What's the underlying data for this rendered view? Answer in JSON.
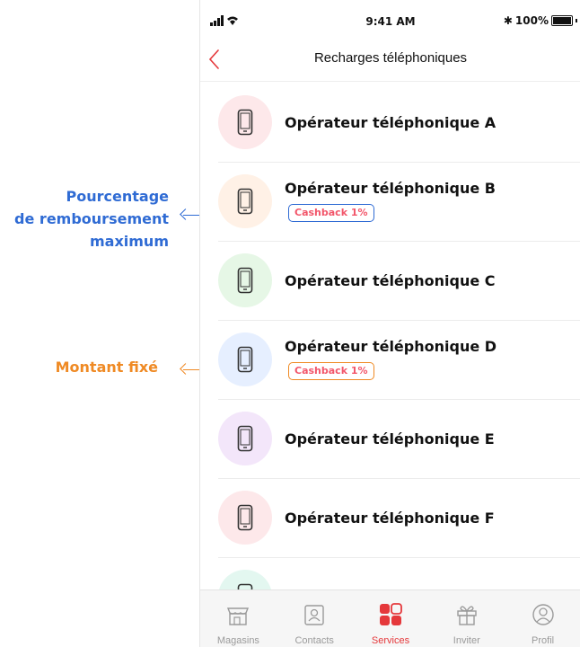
{
  "annotations": {
    "max_refund_lines": [
      "Pourcentage",
      "de remboursement",
      "maximum"
    ],
    "fixed_amount": "Montant fixé",
    "blue_color": "#2f6bd4",
    "orange_color": "#ef8a24"
  },
  "status_bar": {
    "time": "9:41 AM",
    "battery": "100%",
    "icons": [
      "signal-icon",
      "wifi-icon",
      "bluetooth-icon",
      "battery-icon"
    ]
  },
  "nav": {
    "title": "Recharges téléphoniques",
    "back_icon": "chevron-left-icon"
  },
  "operators": [
    {
      "name": "Opérateur téléphonique A",
      "badge": "",
      "circle_color": "#fde8ea"
    },
    {
      "name": "Opérateur téléphonique B",
      "badge": "Cashback 1%",
      "circle_color": "#fff1e6"
    },
    {
      "name": "Opérateur téléphonique C",
      "badge": "",
      "circle_color": "#e6f7e6"
    },
    {
      "name": "Opérateur téléphonique D",
      "badge": "Cashback 1%",
      "circle_color": "#e6efff"
    },
    {
      "name": "Opérateur téléphonique E",
      "badge": "",
      "circle_color": "#f3e6fa"
    },
    {
      "name": "Opérateur téléphonique F",
      "badge": "",
      "circle_color": "#fde8ea"
    }
  ],
  "tabs": [
    {
      "label": "Magasins",
      "icon": "store-icon",
      "active": false
    },
    {
      "label": "Contacts",
      "icon": "contacts-icon",
      "active": false
    },
    {
      "label": "Services",
      "icon": "services-grid-icon",
      "active": true
    },
    {
      "label": "Inviter",
      "icon": "gift-icon",
      "active": false
    },
    {
      "label": "Profil",
      "icon": "profile-icon",
      "active": false
    }
  ],
  "colors": {
    "accent": "#e5383b",
    "badge_text": "#f2566a"
  }
}
